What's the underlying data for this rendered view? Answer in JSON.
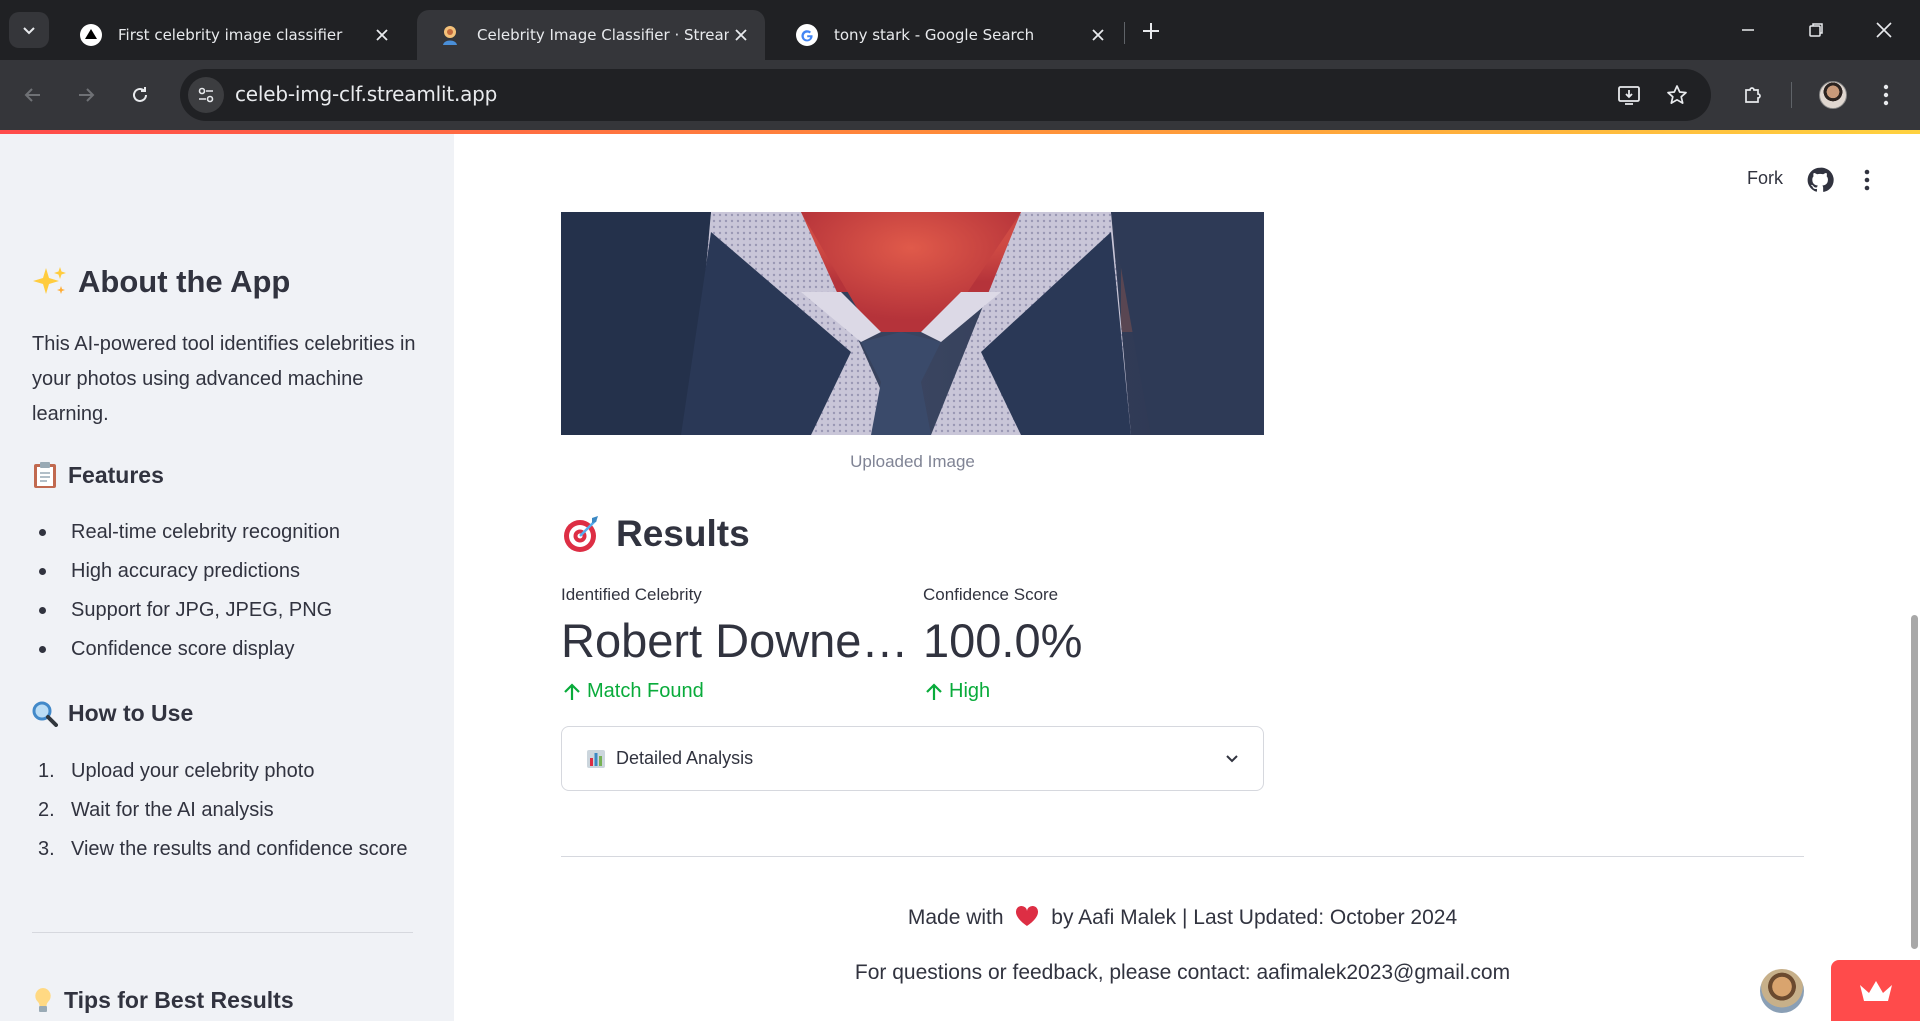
{
  "browser": {
    "tabs": [
      {
        "title": "First celebrity image classifier",
        "favicon": "vercel-triangle-icon",
        "active": false
      },
      {
        "title": "Celebrity Image Classifier · Streamlit",
        "favicon": "streamlit-app-icon",
        "active": true
      },
      {
        "title": "tony stark - Google Search",
        "favicon": "google-g-icon",
        "active": false
      }
    ],
    "url": "celeb-img-clf.streamlit.app"
  },
  "sidebar": {
    "about": {
      "emoji": "sparkles-icon",
      "heading": "About the App",
      "text": "This AI-powered tool identifies celebrities in your photos using advanced machine learning."
    },
    "features": {
      "emoji": "clipboard-icon",
      "heading": "Features",
      "items": [
        "Real-time celebrity recognition",
        "High accuracy predictions",
        "Support for JPG, JPEG, PNG",
        "Confidence score display"
      ]
    },
    "how_to": {
      "emoji": "magnifier-icon",
      "heading": "How to Use",
      "steps": [
        {
          "num": "1.",
          "text": "Upload your celebrity photo"
        },
        {
          "num": "2.",
          "text": "Wait for the AI analysis"
        },
        {
          "num": "3.",
          "text": "View the results and confidence score"
        }
      ]
    },
    "tips": {
      "emoji": "lightbulb-icon",
      "heading": "Tips for Best Results"
    }
  },
  "header": {
    "fork_label": "Fork"
  },
  "main": {
    "image_caption": "Uploaded Image",
    "results_heading": "Results",
    "metrics": [
      {
        "label": "Identified Celebrity",
        "value": "Robert Downe…",
        "delta": "Match Found"
      },
      {
        "label": "Confidence Score",
        "value": "100.0%",
        "delta": "High"
      }
    ],
    "expander_label": "Detailed Analysis",
    "footer": {
      "made_with": "Made with",
      "by_text": "by Aafi Malek | Last Updated: October 2024",
      "contact": "For questions or feedback, please contact: aafimalek2023@gmail.com"
    }
  },
  "colors": {
    "accent": "#ff4b4b",
    "delta_positive": "#09ab3b",
    "sidebar_bg": "#f0f2f6",
    "text": "#31333f"
  }
}
